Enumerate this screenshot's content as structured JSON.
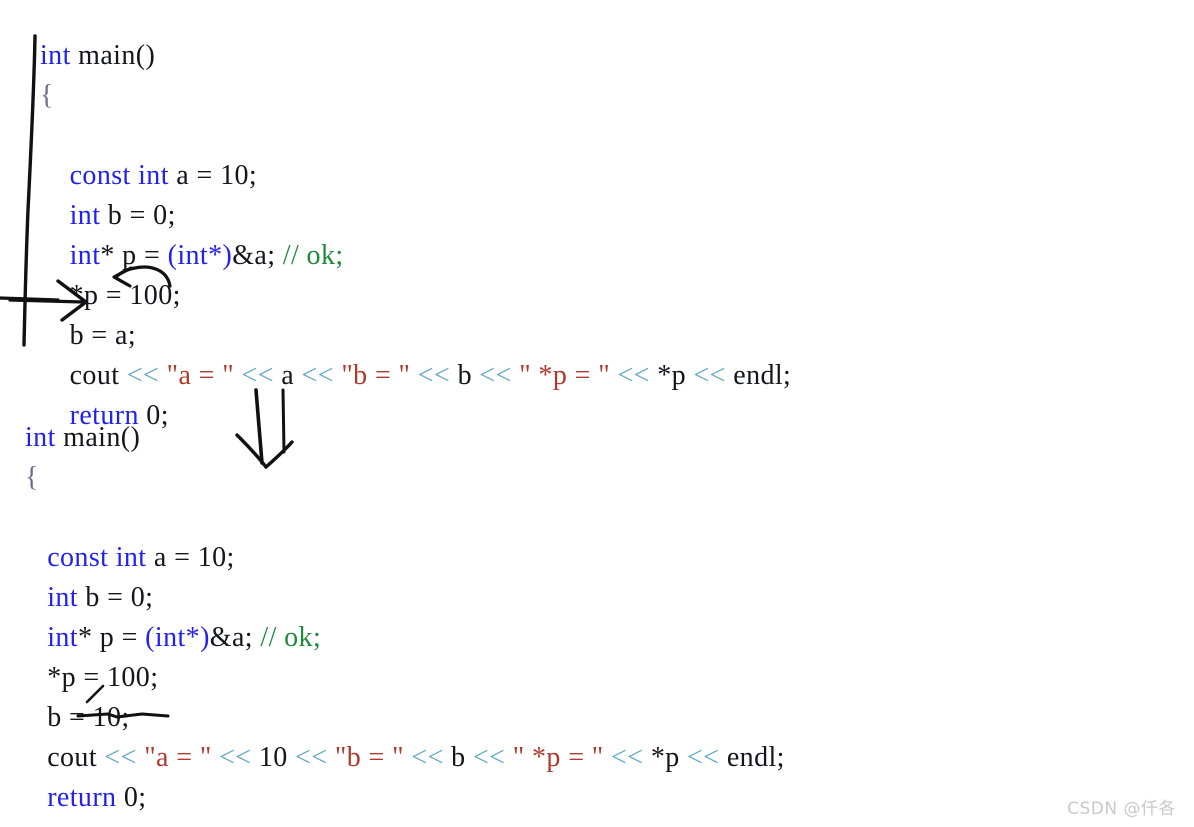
{
  "page": {
    "title": "C++ const cast code example with handwritten annotations",
    "background_color": "#ffffff"
  },
  "colors": {
    "keyword_blue": "#2222ee",
    "string_red": "#b03a2e",
    "comment_green": "#1f8a3c",
    "operator_teal": "#5fa8c4",
    "brace_gray": "#6e6a87",
    "text_black": "#15151e",
    "ink_black": "#000000",
    "watermark_gray": "#c9c9c9"
  },
  "code_block_1": {
    "name": "original-code",
    "lines": [
      {
        "id": "b1-l1",
        "tokens": [
          {
            "t": "int",
            "c": "kw"
          },
          {
            "t": " ",
            "c": "id"
          },
          {
            "t": "main",
            "c": "id"
          },
          {
            "t": "()",
            "c": "punc"
          }
        ]
      },
      {
        "id": "b1-l2",
        "tokens": [
          {
            "t": "{",
            "c": "brace"
          }
        ]
      },
      {
        "id": "b1-l3",
        "tokens": [
          {
            "t": "",
            "c": "id"
          }
        ]
      },
      {
        "id": "b1-l4",
        "tokens": [
          {
            "t": "    ",
            "c": "id"
          },
          {
            "t": "const",
            "c": "kw"
          },
          {
            "t": " ",
            "c": "id"
          },
          {
            "t": "int",
            "c": "kw"
          },
          {
            "t": " a = ",
            "c": "id"
          },
          {
            "t": "10",
            "c": "num"
          },
          {
            "t": ";",
            "c": "punc"
          }
        ]
      },
      {
        "id": "b1-l5",
        "tokens": [
          {
            "t": "    ",
            "c": "id"
          },
          {
            "t": "int",
            "c": "kw"
          },
          {
            "t": " b = ",
            "c": "id"
          },
          {
            "t": "0",
            "c": "num"
          },
          {
            "t": ";",
            "c": "punc"
          }
        ]
      },
      {
        "id": "b1-l6",
        "tokens": [
          {
            "t": "    ",
            "c": "id"
          },
          {
            "t": "int",
            "c": "kw"
          },
          {
            "t": "* p = ",
            "c": "id"
          },
          {
            "t": "(",
            "c": "kw"
          },
          {
            "t": "int",
            "c": "kw"
          },
          {
            "t": "*)",
            "c": "kw"
          },
          {
            "t": "&a; ",
            "c": "id"
          },
          {
            "t": "// ok;",
            "c": "cmt"
          }
        ]
      },
      {
        "id": "b1-l7",
        "tokens": [
          {
            "t": "    *p = ",
            "c": "id"
          },
          {
            "t": "100",
            "c": "num"
          },
          {
            "t": ";",
            "c": "punc"
          }
        ]
      },
      {
        "id": "b1-l8",
        "tokens": [
          {
            "t": "    b = a;",
            "c": "id"
          }
        ]
      },
      {
        "id": "b1-l9",
        "tokens": [
          {
            "t": "    cout ",
            "c": "id"
          },
          {
            "t": "<<",
            "c": "op"
          },
          {
            "t": " ",
            "c": "id"
          },
          {
            "t": "\"a = \"",
            "c": "str"
          },
          {
            "t": " ",
            "c": "id"
          },
          {
            "t": "<<",
            "c": "op"
          },
          {
            "t": " a ",
            "c": "id"
          },
          {
            "t": "<<",
            "c": "op"
          },
          {
            "t": " ",
            "c": "id"
          },
          {
            "t": "\"b = \"",
            "c": "str"
          },
          {
            "t": " ",
            "c": "id"
          },
          {
            "t": "<<",
            "c": "op"
          },
          {
            "t": " b ",
            "c": "id"
          },
          {
            "t": "<<",
            "c": "op"
          },
          {
            "t": " ",
            "c": "id"
          },
          {
            "t": "\" *p = \"",
            "c": "str"
          },
          {
            "t": " ",
            "c": "id"
          },
          {
            "t": "<<",
            "c": "op"
          },
          {
            "t": " *p ",
            "c": "id"
          },
          {
            "t": "<<",
            "c": "op"
          },
          {
            "t": " endl;",
            "c": "id"
          }
        ]
      },
      {
        "id": "b1-l10",
        "tokens": [
          {
            "t": "    ",
            "c": "id"
          },
          {
            "t": "return",
            "c": "kw"
          },
          {
            "t": " ",
            "c": "id"
          },
          {
            "t": "0",
            "c": "num"
          },
          {
            "t": ";",
            "c": "punc"
          }
        ]
      }
    ]
  },
  "code_block_2": {
    "name": "result-code",
    "lines": [
      {
        "id": "b2-l1",
        "tokens": [
          {
            "t": "int",
            "c": "kw"
          },
          {
            "t": " ",
            "c": "id"
          },
          {
            "t": "main",
            "c": "id"
          },
          {
            "t": "()",
            "c": "punc"
          }
        ]
      },
      {
        "id": "b2-l2",
        "tokens": [
          {
            "t": "{",
            "c": "brace"
          }
        ]
      },
      {
        "id": "b2-l3",
        "tokens": [
          {
            "t": "",
            "c": "id"
          }
        ]
      },
      {
        "id": "b2-l4",
        "tokens": [
          {
            "t": "   ",
            "c": "id"
          },
          {
            "t": "const",
            "c": "kw"
          },
          {
            "t": " ",
            "c": "id"
          },
          {
            "t": "int",
            "c": "kw"
          },
          {
            "t": " a = ",
            "c": "id"
          },
          {
            "t": "10",
            "c": "num"
          },
          {
            "t": ";",
            "c": "punc"
          }
        ]
      },
      {
        "id": "b2-l5",
        "tokens": [
          {
            "t": "   ",
            "c": "id"
          },
          {
            "t": "int",
            "c": "kw"
          },
          {
            "t": " b = ",
            "c": "id"
          },
          {
            "t": "0",
            "c": "num"
          },
          {
            "t": ";",
            "c": "punc"
          }
        ]
      },
      {
        "id": "b2-l6",
        "tokens": [
          {
            "t": "   ",
            "c": "id"
          },
          {
            "t": "int",
            "c": "kw"
          },
          {
            "t": "* p = ",
            "c": "id"
          },
          {
            "t": "(",
            "c": "kw"
          },
          {
            "t": "int",
            "c": "kw"
          },
          {
            "t": "*)",
            "c": "kw"
          },
          {
            "t": "&a; ",
            "c": "id"
          },
          {
            "t": "// ok;",
            "c": "cmt"
          }
        ]
      },
      {
        "id": "b2-l7",
        "tokens": [
          {
            "t": "   *p = ",
            "c": "id"
          },
          {
            "t": "100",
            "c": "num"
          },
          {
            "t": ";",
            "c": "punc"
          }
        ]
      },
      {
        "id": "b2-l8",
        "tokens": [
          {
            "t": "   b = ",
            "c": "id"
          },
          {
            "t": "10",
            "c": "num"
          },
          {
            "t": ";",
            "c": "punc"
          }
        ]
      },
      {
        "id": "b2-l9",
        "tokens": [
          {
            "t": "   cout ",
            "c": "id"
          },
          {
            "t": "<<",
            "c": "op"
          },
          {
            "t": " ",
            "c": "id"
          },
          {
            "t": "\"a = \"",
            "c": "str"
          },
          {
            "t": " ",
            "c": "id"
          },
          {
            "t": "<<",
            "c": "op"
          },
          {
            "t": " ",
            "c": "id"
          },
          {
            "t": "10",
            "c": "num"
          },
          {
            "t": " ",
            "c": "id"
          },
          {
            "t": "<<",
            "c": "op"
          },
          {
            "t": " ",
            "c": "id"
          },
          {
            "t": "\"b = \"",
            "c": "str"
          },
          {
            "t": " ",
            "c": "id"
          },
          {
            "t": "<<",
            "c": "op"
          },
          {
            "t": " b ",
            "c": "id"
          },
          {
            "t": "<<",
            "c": "op"
          },
          {
            "t": " ",
            "c": "id"
          },
          {
            "t": "\" *p = \"",
            "c": "str"
          },
          {
            "t": " ",
            "c": "id"
          },
          {
            "t": "<<",
            "c": "op"
          },
          {
            "t": " *p ",
            "c": "id"
          },
          {
            "t": "<<",
            "c": "op"
          },
          {
            "t": " endl;",
            "c": "id"
          }
        ]
      },
      {
        "id": "b2-l10",
        "tokens": [
          {
            "t": "   ",
            "c": "id"
          },
          {
            "t": "return",
            "c": "kw"
          },
          {
            "t": " ",
            "c": "id"
          },
          {
            "t": "0",
            "c": "num"
          },
          {
            "t": ";",
            "c": "punc"
          }
        ]
      }
    ]
  },
  "annotations": [
    {
      "name": "vertical-brace-line",
      "kind": "freehand-line",
      "description": "long hand-drawn vertical line at left of first code block"
    },
    {
      "name": "right-pointing-arrow",
      "kind": "freehand-arrow",
      "description": "horizontal arrow pointing at the b = a; line"
    },
    {
      "name": "curved-back-arrow",
      "kind": "freehand-arrow",
      "description": "curved arrow from a back to b in b = a;"
    },
    {
      "name": "down-arrow",
      "kind": "freehand-arrow",
      "description": "large double-stroke downward arrow between code blocks"
    },
    {
      "name": "strike-underline",
      "kind": "freehand-underline",
      "description": "strike through b and underline under b = 1 in second block"
    }
  ],
  "watermark": {
    "text": "CSDN @仟各"
  }
}
